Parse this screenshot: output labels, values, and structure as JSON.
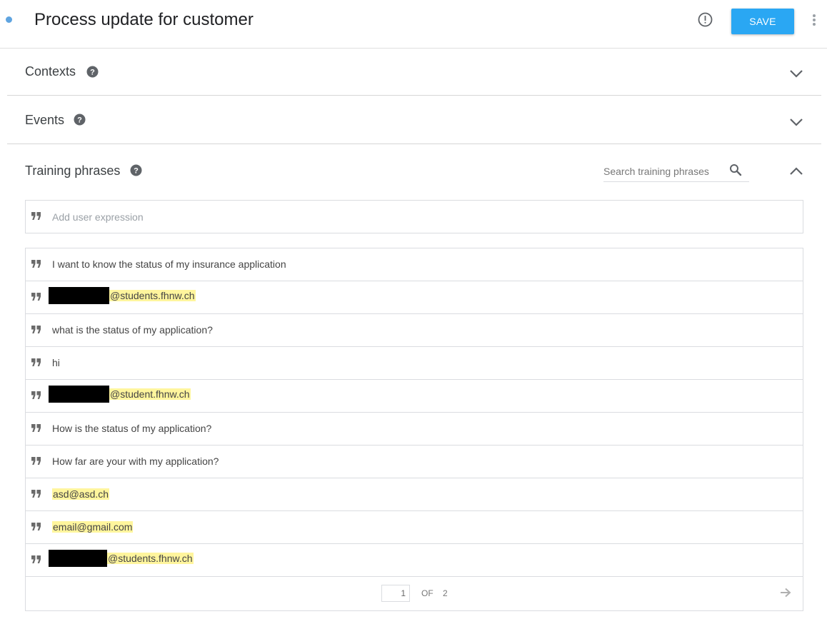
{
  "header": {
    "title": "Process update for customer",
    "save_label": "SAVE",
    "status_dot_color": "#5fa4e0",
    "save_color": "#2aa7f3",
    "icons": [
      "alert-circle-icon",
      "more-vert-icon"
    ]
  },
  "sections": {
    "contexts": {
      "title": "Contexts"
    },
    "events": {
      "title": "Events"
    },
    "training": {
      "title": "Training phrases",
      "search_placeholder": "Search training phrases",
      "add_placeholder": "Add user expression"
    }
  },
  "phrases": [
    {
      "text": "I want to know the status of my insurance application",
      "highlight": false,
      "redacted": false
    },
    {
      "text": "@students.fhnw.ch",
      "highlight": true,
      "redacted": true
    },
    {
      "text": "what is the status of my application?",
      "highlight": false,
      "redacted": false
    },
    {
      "text": "hi",
      "highlight": false,
      "redacted": false
    },
    {
      "text": "@student.fhnw.ch",
      "highlight": true,
      "redacted": true
    },
    {
      "text": "How is the status of my application?",
      "highlight": false,
      "redacted": false
    },
    {
      "text": "How far are your with my application?",
      "highlight": false,
      "redacted": false
    },
    {
      "text": "asd@asd.ch",
      "highlight": true,
      "redacted": false
    },
    {
      "text": "email@gmail.com",
      "highlight": true,
      "redacted": false
    },
    {
      "text": "@students.fhnw.ch",
      "highlight": true,
      "redacted": true
    }
  ],
  "pagination": {
    "current": "1",
    "of_label": "OF",
    "total": "2"
  },
  "highlight_color": "#fff59d"
}
